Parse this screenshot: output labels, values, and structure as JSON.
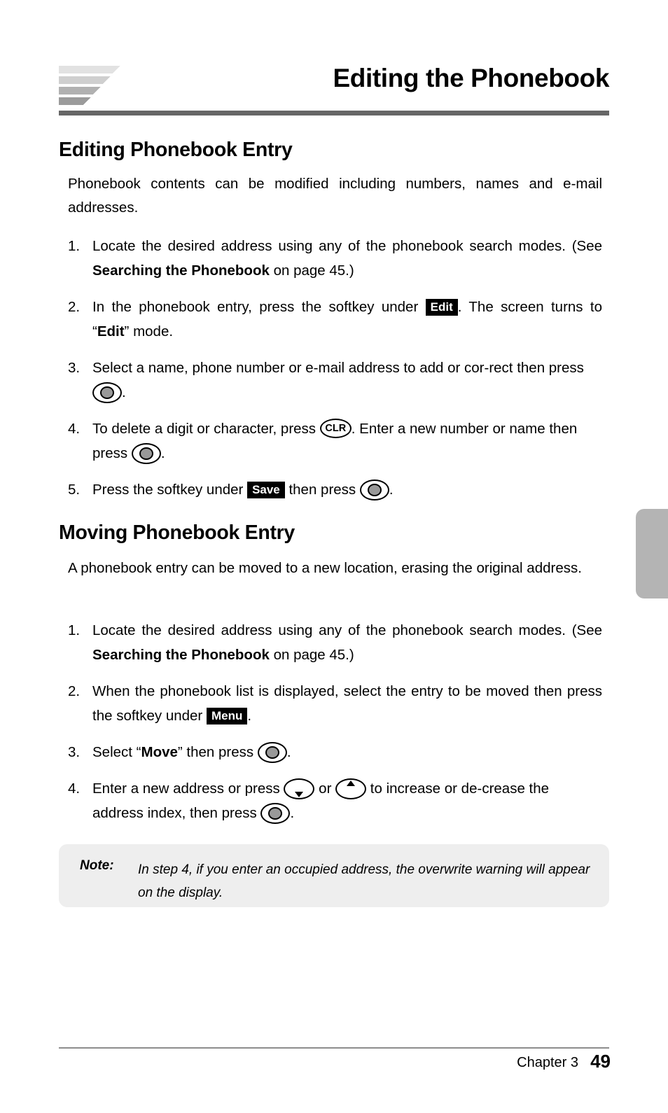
{
  "header": {
    "title": "Editing the Phonebook",
    "logo_name": "chevron-stack-logo"
  },
  "sections": [
    {
      "heading": "Editing Phonebook Entry",
      "intro": "Phonebook contents can be modified including numbers, names and e-mail addresses."
    },
    {
      "heading": "Moving Phonebook Entry",
      "intro": "A phonebook entry can be moved to a new location, erasing the original address."
    }
  ],
  "editing_steps": {
    "s1_num": "1.",
    "s1_a": "Locate the desired address using any of the phonebook search modes. (See ",
    "s1_bold": "Searching the Phonebook",
    "s1_b": " on page 45.)",
    "s2_num": "2.",
    "s2_a": "In the phonebook entry, press the softkey under ",
    "s2_key": "Edit",
    "s2_b": ".  The screen turns to “",
    "s2_bold": "Edit",
    "s2_c": "” mode.",
    "s3_num": "3.",
    "s3_a": "Select a name, phone number or e-mail address to add or cor-rect then press ",
    "s3_b": ".",
    "s4_num": "4.",
    "s4_a": "To delete a digit or character, press ",
    "s4_clr": "CLR",
    "s4_b": ". Enter a new number or name then press ",
    "s4_c": ".",
    "s5_num": "5.",
    "s5_a": "Press the softkey under ",
    "s5_key": "Save",
    "s5_b": " then press ",
    "s5_c": "."
  },
  "moving_steps": {
    "m1_num": "1.",
    "m1_a": "Locate the desired address using any of the phonebook search modes. (See ",
    "m1_bold": "Searching the Phonebook",
    "m1_b": " on page 45.)",
    "m2_num": "2.",
    "m2_a": "When the phonebook list is displayed, select the entry to be moved then press the softkey under ",
    "m2_key": "Menu",
    "m2_b": ".",
    "m3_num": "3.",
    "m3_a": "Select “",
    "m3_bold": "Move",
    "m3_b": "” then press ",
    "m3_c": ".",
    "m4_num": "4.",
    "m4_a": "Enter a new address or press ",
    "m4_or": " or ",
    "m4_b": " to increase or de-crease the address index, then press ",
    "m4_c": "."
  },
  "note": {
    "label": "Note:",
    "text": "In step 4, if you enter an occupied address, the overwrite warning will appear on the display."
  },
  "footer": {
    "chapter": "Chapter 3",
    "page": "49"
  },
  "colors": {
    "rule": "#676767",
    "note_bg": "#eeeeee",
    "tab": "#b4b4b4",
    "key_dot": "#999999"
  }
}
